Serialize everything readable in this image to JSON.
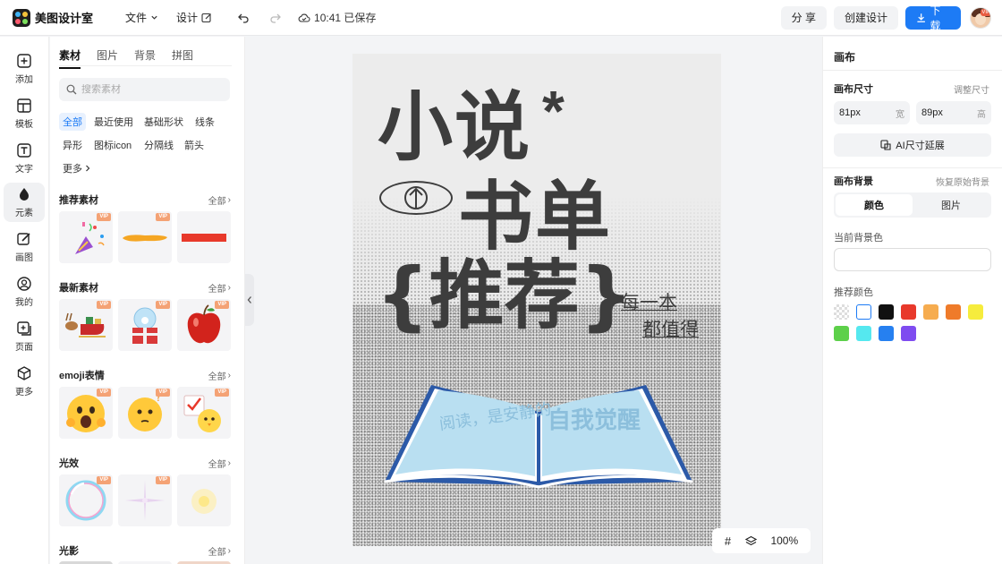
{
  "app": {
    "name": "美图设计室",
    "brand_color": "#1d7bf5"
  },
  "topbar": {
    "file_menu": "文件",
    "design_menu": "设计",
    "save_status": "10:41 已保存",
    "share": "分 享",
    "create": "创建设计",
    "download": "下载",
    "avatar_badge": "VIP"
  },
  "leftnav": {
    "items": [
      {
        "label": "添加",
        "icon": "plus-square-icon"
      },
      {
        "label": "模板",
        "icon": "template-icon"
      },
      {
        "label": "文字",
        "icon": "text-icon"
      },
      {
        "label": "元素",
        "icon": "element-icon",
        "active": true
      },
      {
        "label": "画图",
        "icon": "draw-icon"
      },
      {
        "label": "我的",
        "icon": "user-icon"
      },
      {
        "label": "页面",
        "icon": "page-add-icon"
      },
      {
        "label": "更多",
        "icon": "cube-icon"
      }
    ]
  },
  "panel": {
    "tabs": [
      "素材",
      "图片",
      "背景",
      "拼图"
    ],
    "search_placeholder": "搜索素材",
    "chips": [
      "全部",
      "最近使用",
      "基础形状",
      "线条",
      "异形",
      "图标icon",
      "分隔线",
      "箭头",
      "更多"
    ],
    "all_label": "全部",
    "vip": "VIP",
    "sections": [
      "推荐素材",
      "最新素材",
      "emoji表情",
      "光效",
      "光影"
    ]
  },
  "canvas": {
    "line1": "小说",
    "star": "*",
    "line2": "书单",
    "line3": "{推荐}",
    "line4": "每一本",
    "line5": "都值得",
    "book_text_left": "阅读，是安静的",
    "book_text_right": "自我觉醒"
  },
  "zoom": {
    "value": "100%"
  },
  "rpanel": {
    "title": "画布",
    "size_label": "画布尺寸",
    "size_link": "调整尺寸",
    "width_value": "81px",
    "width_unit": "宽",
    "height_value": "89px",
    "height_unit": "高",
    "ai_extend": "AI尺寸延展",
    "bg_label": "画布背景",
    "bg_restore": "恢复原始背景",
    "seg_color": "颜色",
    "seg_image": "图片",
    "current_bg": "当前背景色",
    "recommend_colors_label": "推荐颜色",
    "swatches": [
      "transparent",
      "#ffffff",
      "#111111",
      "#e8392b",
      "#f6ac4f",
      "#ef7b2a",
      "#f6ec3d",
      "#5dd04a",
      "#55e8ef",
      "#2680f0",
      "#7f4cf0"
    ]
  }
}
